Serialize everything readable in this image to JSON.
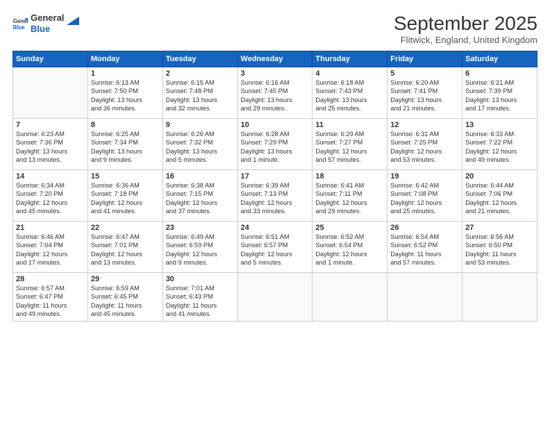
{
  "header": {
    "logo_general": "General",
    "logo_blue": "Blue",
    "month": "September 2025",
    "location": "Flitwick, England, United Kingdom"
  },
  "days_of_week": [
    "Sunday",
    "Monday",
    "Tuesday",
    "Wednesday",
    "Thursday",
    "Friday",
    "Saturday"
  ],
  "weeks": [
    [
      {
        "day": "",
        "empty": true
      },
      {
        "day": "1",
        "lines": [
          "Sunrise: 6:13 AM",
          "Sunset: 7:50 PM",
          "Daylight: 13 hours",
          "and 36 minutes."
        ]
      },
      {
        "day": "2",
        "lines": [
          "Sunrise: 6:15 AM",
          "Sunset: 7:48 PM",
          "Daylight: 13 hours",
          "and 32 minutes."
        ]
      },
      {
        "day": "3",
        "lines": [
          "Sunrise: 6:16 AM",
          "Sunset: 7:45 PM",
          "Daylight: 13 hours",
          "and 29 minutes."
        ]
      },
      {
        "day": "4",
        "lines": [
          "Sunrise: 6:18 AM",
          "Sunset: 7:43 PM",
          "Daylight: 13 hours",
          "and 25 minutes."
        ]
      },
      {
        "day": "5",
        "lines": [
          "Sunrise: 6:20 AM",
          "Sunset: 7:41 PM",
          "Daylight: 13 hours",
          "and 21 minutes."
        ]
      },
      {
        "day": "6",
        "lines": [
          "Sunrise: 6:21 AM",
          "Sunset: 7:39 PM",
          "Daylight: 13 hours",
          "and 17 minutes."
        ]
      }
    ],
    [
      {
        "day": "7",
        "lines": [
          "Sunrise: 6:23 AM",
          "Sunset: 7:36 PM",
          "Daylight: 13 hours",
          "and 13 minutes."
        ]
      },
      {
        "day": "8",
        "lines": [
          "Sunrise: 6:25 AM",
          "Sunset: 7:34 PM",
          "Daylight: 13 hours",
          "and 9 minutes."
        ]
      },
      {
        "day": "9",
        "lines": [
          "Sunrise: 6:26 AM",
          "Sunset: 7:32 PM",
          "Daylight: 13 hours",
          "and 5 minutes."
        ]
      },
      {
        "day": "10",
        "lines": [
          "Sunrise: 6:28 AM",
          "Sunset: 7:29 PM",
          "Daylight: 13 hours",
          "and 1 minute."
        ]
      },
      {
        "day": "11",
        "lines": [
          "Sunrise: 6:29 AM",
          "Sunset: 7:27 PM",
          "Daylight: 12 hours",
          "and 57 minutes."
        ]
      },
      {
        "day": "12",
        "lines": [
          "Sunrise: 6:31 AM",
          "Sunset: 7:25 PM",
          "Daylight: 12 hours",
          "and 53 minutes."
        ]
      },
      {
        "day": "13",
        "lines": [
          "Sunrise: 6:33 AM",
          "Sunset: 7:22 PM",
          "Daylight: 12 hours",
          "and 49 minutes."
        ]
      }
    ],
    [
      {
        "day": "14",
        "lines": [
          "Sunrise: 6:34 AM",
          "Sunset: 7:20 PM",
          "Daylight: 12 hours",
          "and 45 minutes."
        ]
      },
      {
        "day": "15",
        "lines": [
          "Sunrise: 6:36 AM",
          "Sunset: 7:18 PM",
          "Daylight: 12 hours",
          "and 41 minutes."
        ]
      },
      {
        "day": "16",
        "lines": [
          "Sunrise: 6:38 AM",
          "Sunset: 7:15 PM",
          "Daylight: 12 hours",
          "and 37 minutes."
        ]
      },
      {
        "day": "17",
        "lines": [
          "Sunrise: 6:39 AM",
          "Sunset: 7:13 PM",
          "Daylight: 12 hours",
          "and 33 minutes."
        ]
      },
      {
        "day": "18",
        "lines": [
          "Sunrise: 6:41 AM",
          "Sunset: 7:11 PM",
          "Daylight: 12 hours",
          "and 29 minutes."
        ]
      },
      {
        "day": "19",
        "lines": [
          "Sunrise: 6:42 AM",
          "Sunset: 7:08 PM",
          "Daylight: 12 hours",
          "and 25 minutes."
        ]
      },
      {
        "day": "20",
        "lines": [
          "Sunrise: 6:44 AM",
          "Sunset: 7:06 PM",
          "Daylight: 12 hours",
          "and 21 minutes."
        ]
      }
    ],
    [
      {
        "day": "21",
        "lines": [
          "Sunrise: 6:46 AM",
          "Sunset: 7:04 PM",
          "Daylight: 12 hours",
          "and 17 minutes."
        ]
      },
      {
        "day": "22",
        "lines": [
          "Sunrise: 6:47 AM",
          "Sunset: 7:01 PM",
          "Daylight: 12 hours",
          "and 13 minutes."
        ]
      },
      {
        "day": "23",
        "lines": [
          "Sunrise: 6:49 AM",
          "Sunset: 6:59 PM",
          "Daylight: 12 hours",
          "and 9 minutes."
        ]
      },
      {
        "day": "24",
        "lines": [
          "Sunrise: 6:51 AM",
          "Sunset: 6:57 PM",
          "Daylight: 12 hours",
          "and 5 minutes."
        ]
      },
      {
        "day": "25",
        "lines": [
          "Sunrise: 6:52 AM",
          "Sunset: 6:54 PM",
          "Daylight: 12 hours",
          "and 1 minute."
        ]
      },
      {
        "day": "26",
        "lines": [
          "Sunrise: 6:54 AM",
          "Sunset: 6:52 PM",
          "Daylight: 11 hours",
          "and 57 minutes."
        ]
      },
      {
        "day": "27",
        "lines": [
          "Sunrise: 6:56 AM",
          "Sunset: 6:50 PM",
          "Daylight: 11 hours",
          "and 53 minutes."
        ]
      }
    ],
    [
      {
        "day": "28",
        "lines": [
          "Sunrise: 6:57 AM",
          "Sunset: 6:47 PM",
          "Daylight: 11 hours",
          "and 49 minutes."
        ]
      },
      {
        "day": "29",
        "lines": [
          "Sunrise: 6:59 AM",
          "Sunset: 6:45 PM",
          "Daylight: 11 hours",
          "and 45 minutes."
        ]
      },
      {
        "day": "30",
        "lines": [
          "Sunrise: 7:01 AM",
          "Sunset: 6:43 PM",
          "Daylight: 11 hours",
          "and 41 minutes."
        ]
      },
      {
        "day": "",
        "empty": true
      },
      {
        "day": "",
        "empty": true
      },
      {
        "day": "",
        "empty": true
      },
      {
        "day": "",
        "empty": true
      }
    ]
  ]
}
